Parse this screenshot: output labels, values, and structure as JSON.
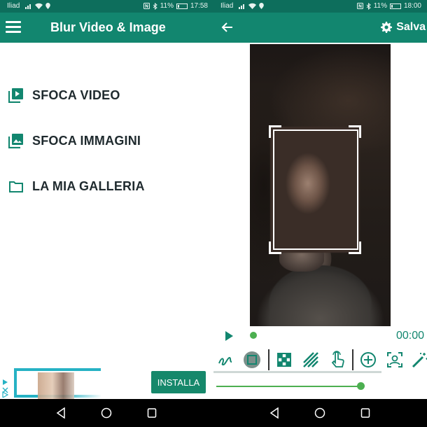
{
  "left": {
    "status": {
      "carrier": "Iliad",
      "battery": "11%",
      "time": "17:58"
    },
    "appbar": {
      "title": "Blur Video & Image"
    },
    "menu": [
      {
        "label": "SFOCA VIDEO",
        "icon": "video-library-icon"
      },
      {
        "label": "SFOCA IMMAGINI",
        "icon": "image-library-icon"
      },
      {
        "label": "LA MIA GALLERIA",
        "icon": "folder-icon"
      }
    ],
    "ad": {
      "install_label": "INSTALLA"
    }
  },
  "right": {
    "status": {
      "carrier": "Iliad",
      "battery": "11%",
      "time": "18:00"
    },
    "appbar": {
      "save_label": "Salva"
    },
    "player": {
      "time": "00:00",
      "progress": 0,
      "brush_size_fraction": 0.97
    },
    "tools": [
      "brush-icon",
      "shape-icon",
      "mosaic-icon",
      "stripes-icon",
      "touch-icon",
      "zoom-in-icon",
      "face-detect-icon",
      "magic-wand-icon"
    ]
  },
  "colors": {
    "primary": "#12866f",
    "statusbar": "#0d6e5c",
    "accent": "#4caf50",
    "ad_border": "#26b2c4"
  }
}
